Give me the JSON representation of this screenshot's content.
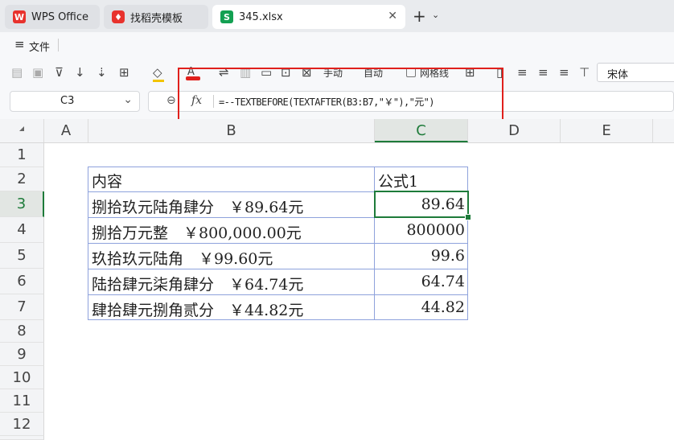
{
  "tabs": [
    {
      "label": "WPS Office",
      "icon": "wps-logo-icon"
    },
    {
      "label": "找稻壳模板",
      "icon": "docer-icon"
    },
    {
      "label": "345.xlsx",
      "icon": "sheet-icon",
      "badge": "S",
      "active": true
    }
  ],
  "menu": {
    "file_label": "文件"
  },
  "toolbar": {
    "manual_label": "手动",
    "auto_label": "自动",
    "gridlines_label": "网格线",
    "font_name": "宋体"
  },
  "formula_bar": {
    "cell_ref": "C3",
    "fx_label": "fx",
    "formula": "=--TEXTBEFORE(TEXTAFTER(B3:B7,\"￥\"),\"元\")"
  },
  "sheet": {
    "columns": [
      "A",
      "B",
      "C",
      "D",
      "E"
    ],
    "rows": [
      "1",
      "2",
      "3",
      "4",
      "5",
      "6",
      "7",
      "8",
      "9",
      "10",
      "11",
      "12"
    ],
    "header_b": "内容",
    "header_c": "公式1",
    "data": [
      {
        "b": "捌拾玖元陆角肆分　￥89.64元",
        "c": "89.64"
      },
      {
        "b": "捌拾万元整　￥800,000.00元",
        "c": "800000"
      },
      {
        "b": "玖拾玖元陆角　￥99.60元",
        "c": "99.6"
      },
      {
        "b": "陆拾肆元柒角肆分　￥64.74元",
        "c": "64.74"
      },
      {
        "b": "肆拾肆元捌角贰分　￥44.82元",
        "c": "44.82"
      }
    ],
    "active_cell": "C3",
    "accent_color": "#1e7b3a",
    "highlight_color": "#e0201c"
  }
}
